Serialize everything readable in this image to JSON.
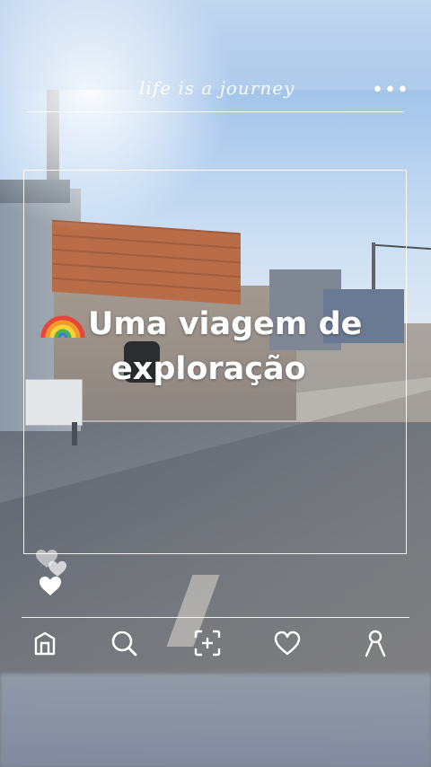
{
  "story": {
    "header_text": "life is a journey",
    "more_label": "•••",
    "headline_emoji": "rainbow-icon",
    "headline_line1": "Uma viagem de",
    "headline_line2": "exploração"
  },
  "bottom_nav": {
    "items": [
      {
        "name": "home",
        "icon": "home-icon"
      },
      {
        "name": "search",
        "icon": "search-icon"
      },
      {
        "name": "add-post",
        "icon": "add-post-icon"
      },
      {
        "name": "likes",
        "icon": "heart-icon"
      },
      {
        "name": "profile",
        "icon": "profile-icon"
      }
    ]
  },
  "colors": {
    "overlay_white": "#ffffff",
    "sky": "#a9c8ec"
  }
}
